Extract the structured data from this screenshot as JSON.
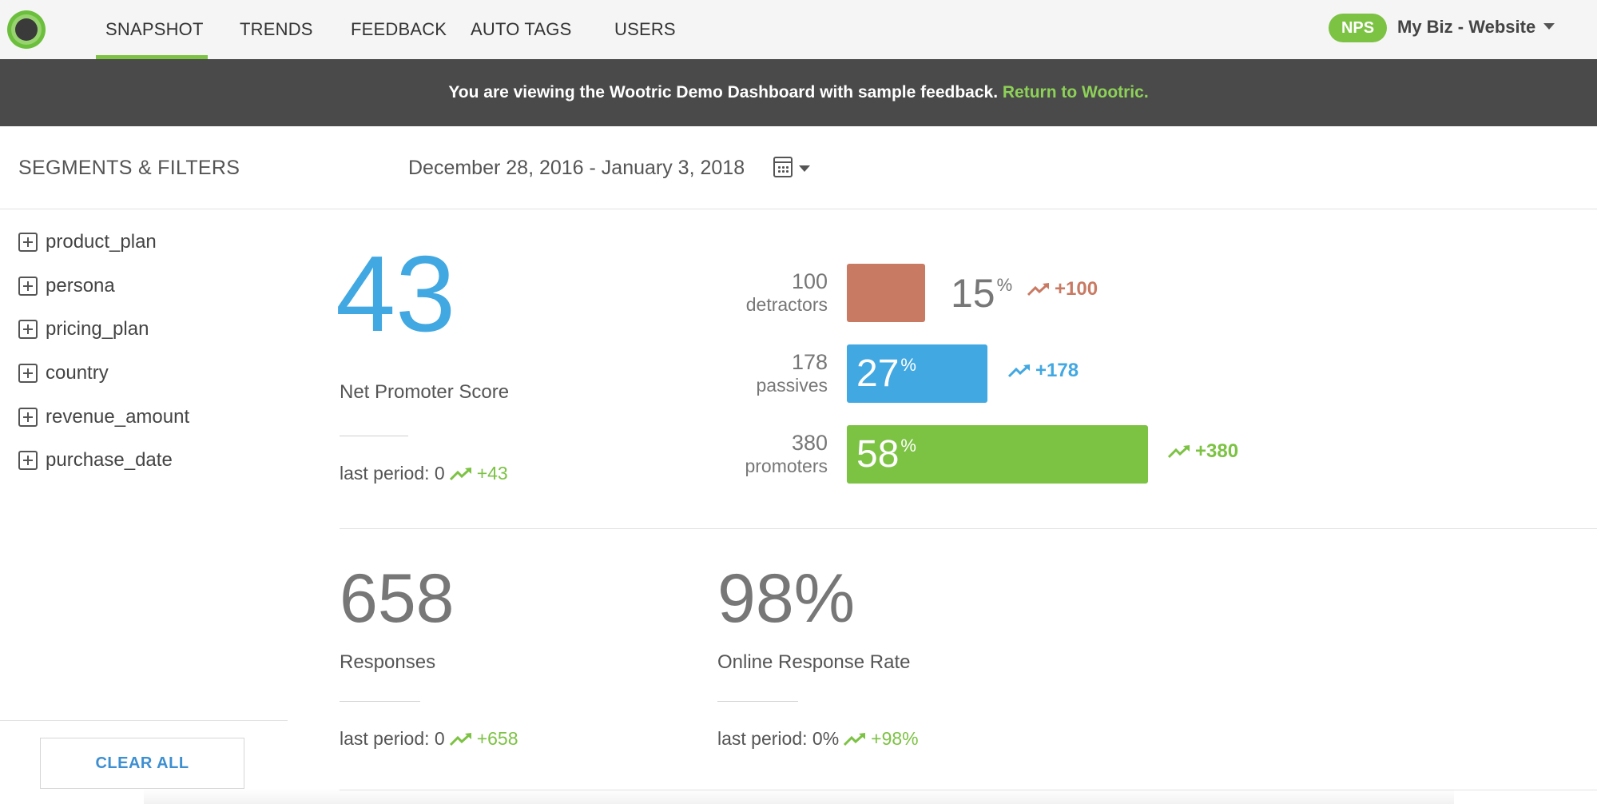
{
  "nav": {
    "items": [
      {
        "label": "SNAPSHOT",
        "active": true
      },
      {
        "label": "TRENDS"
      },
      {
        "label": "FEEDBACK"
      },
      {
        "label": "AUTO TAGS"
      },
      {
        "label": "USERS"
      }
    ],
    "nps_badge": "NPS",
    "site_label": "My Biz - Website",
    "accent_color": "#7cc243"
  },
  "banner": {
    "text": "You are viewing the Wootric Demo Dashboard with sample feedback.",
    "link": "Return to Wootric."
  },
  "filters": {
    "title": "SEGMENTS & FILTERS",
    "date_range": "December 28, 2016 - January 3, 2018",
    "calendar_icon": "calendar-icon",
    "items": [
      "product_plan",
      "persona",
      "pricing_plan",
      "country",
      "revenue_amount",
      "purchase_date"
    ],
    "clear_label": "CLEAR ALL"
  },
  "nps": {
    "score": "43",
    "label": "Net Promoter Score",
    "last_period_label": "last period: 0",
    "delta": "+43",
    "score_color": "#42a8e2"
  },
  "distribution": {
    "detractors": {
      "count": "100",
      "label": "detractors",
      "pct": "15",
      "pct_suffix": "%",
      "delta": "+100",
      "color": "#c97a63",
      "share": 0.15
    },
    "passives": {
      "count": "178",
      "label": "passives",
      "pct": "27",
      "pct_suffix": "%",
      "delta": "+178",
      "color": "#42a8e2",
      "share": 0.27
    },
    "promoters": {
      "count": "380",
      "label": "promoters",
      "pct": "58",
      "pct_suffix": "%",
      "delta": "+380",
      "color": "#7cc243",
      "share": 0.58
    }
  },
  "responses": {
    "value": "658",
    "label": "Responses",
    "last_period_label": "last period: 0",
    "delta": "+658"
  },
  "response_rate": {
    "value": "98%",
    "label": "Online Response Rate",
    "last_period_label": "last period: 0%",
    "delta": "+98%"
  }
}
